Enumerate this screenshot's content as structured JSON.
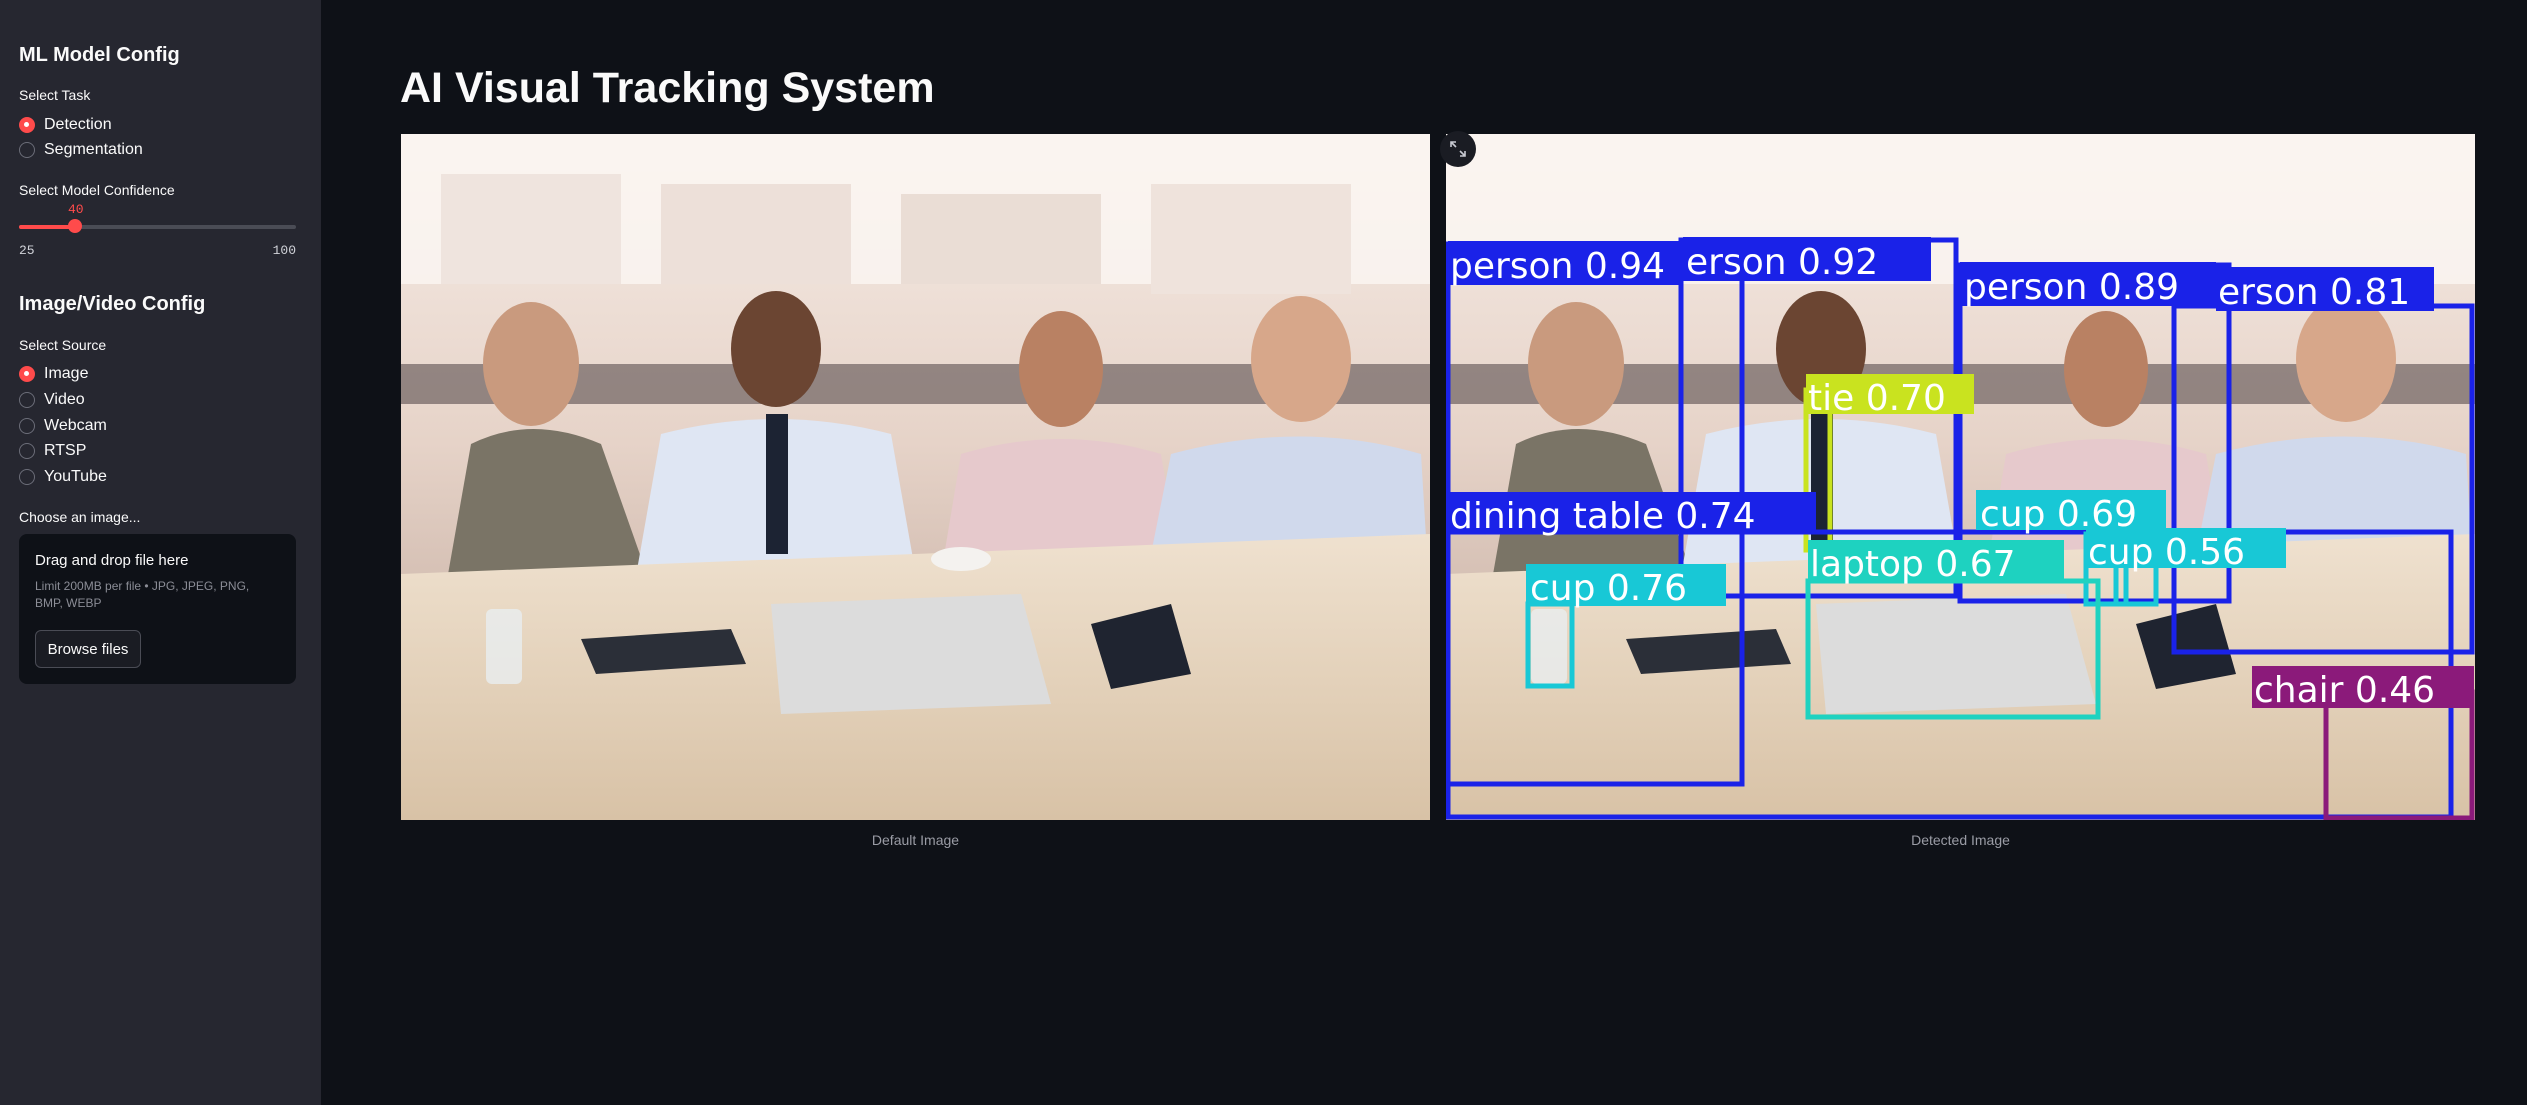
{
  "sidebar": {
    "model_title": "ML Model Config",
    "task_label": "Select Task",
    "task_options": [
      "Detection",
      "Segmentation"
    ],
    "task_selected": "Detection",
    "confidence_label": "Select Model Confidence",
    "confidence": {
      "value": "40",
      "min": "25",
      "max": "100"
    },
    "source_title": "Image/Video Config",
    "source_label": "Select Source",
    "source_options": [
      "Image",
      "Video",
      "Webcam",
      "RTSP",
      "YouTube"
    ],
    "source_selected": "Image",
    "uploader": {
      "label": "Choose an image...",
      "drop_text": "Drag and drop file here",
      "limit_text": "Limit 200MB per file • JPG, JPEG, PNG, BMP, WEBP",
      "browse_label": "Browse files"
    }
  },
  "main": {
    "title": "AI Visual Tracking System",
    "default_caption": "Default Image",
    "detected_caption": "Detected Image",
    "expand_icon": "expand-icon"
  },
  "detections": [
    {
      "label": "person 0.94",
      "color": "#1a22e8"
    },
    {
      "label": "erson 0.92",
      "color": "#1a22e8"
    },
    {
      "label": "person 0.89",
      "color": "#1a22e8"
    },
    {
      "label": "erson 0.81",
      "color": "#1a22e8"
    },
    {
      "label": "tie 0.70",
      "color": "#c9e31f"
    },
    {
      "label": "dining table 0.74",
      "color": "#1a22e8"
    },
    {
      "label": "cup 0.69",
      "color": "#18c8d6"
    },
    {
      "label": "cup 0.56",
      "color": "#18c8d6"
    },
    {
      "label": "laptop 0.67",
      "color": "#1ed2c0"
    },
    {
      "label": "cup 0.76",
      "color": "#18c8d6"
    },
    {
      "label": "chair 0.46",
      "color": "#8b1a7a"
    }
  ],
  "colors": {
    "accent": "#ff4b4b",
    "sidebar_bg": "#262730",
    "app_bg": "#0e1117"
  }
}
